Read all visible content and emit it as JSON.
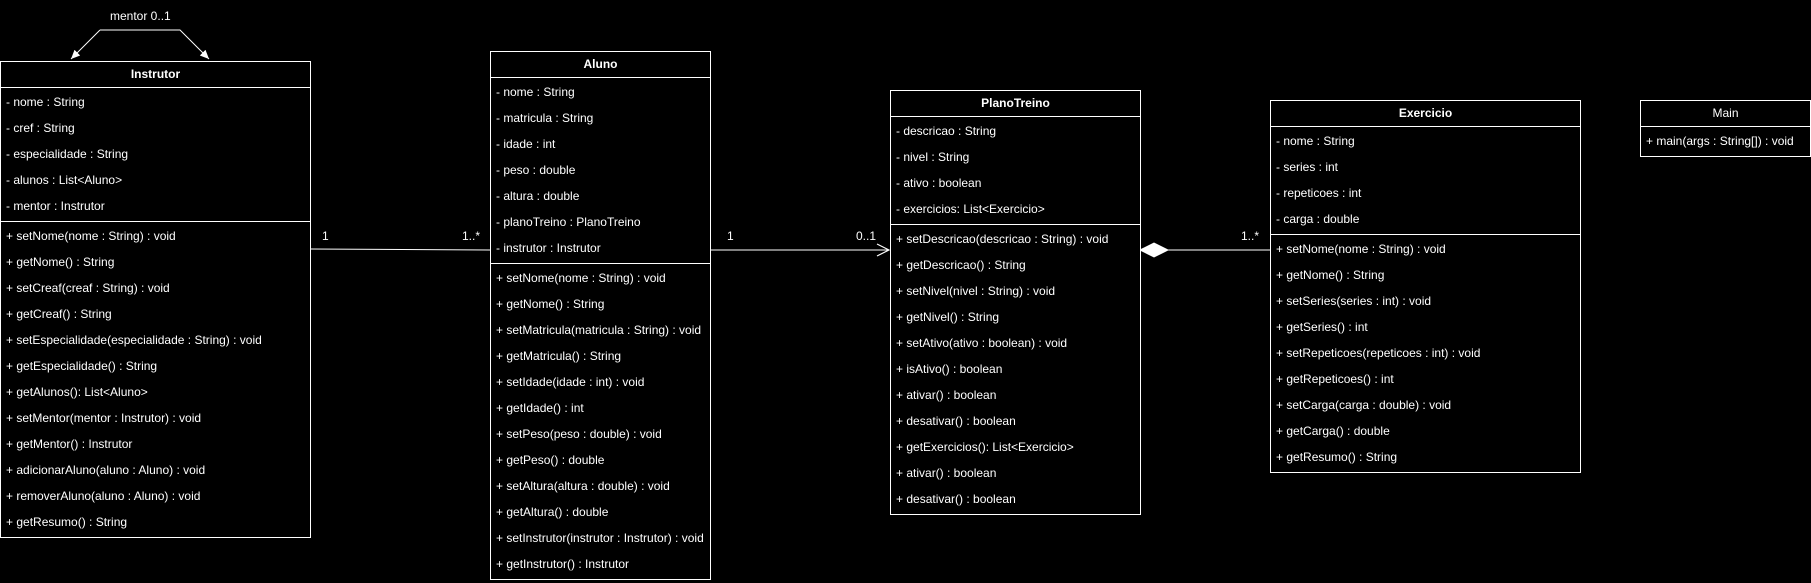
{
  "colors": {
    "background": "#000000",
    "stroke": "#ffffff",
    "text": "#ffffff"
  },
  "classes": {
    "instrutor": {
      "name": "Instrutor",
      "attributes": [
        "- nome : String",
        "- cref : String",
        "- especialidade : String",
        "- alunos : List<Aluno>",
        "- mentor : Instrutor"
      ],
      "methods": [
        "+ setNome(nome : String) : void",
        "+ getNome() : String",
        "+ setCreaf(creaf : String) : void",
        "+ getCreaf() : String",
        "+ setEspecialidade(especialidade : String) : void",
        "+ getEspecialidade() : String",
        "+ getAlunos(): List<Aluno>",
        "+ setMentor(mentor : Instrutor) : void",
        "+ getMentor() : Instrutor",
        "+ adicionarAluno(aluno : Aluno) : void",
        "+ removerAluno(aluno : Aluno) : void",
        "+ getResumo() : String"
      ]
    },
    "aluno": {
      "name": "Aluno",
      "attributes": [
        "- nome : String",
        "- matricula : String",
        "- idade : int",
        "- peso : double",
        "- altura : double",
        "- planoTreino : PlanoTreino",
        "- instrutor : Instrutor"
      ],
      "methods": [
        "+ setNome(nome : String) : void",
        "+ getNome() : String",
        "+ setMatricula(matricula : String) : void",
        "+ getMatricula() : String",
        "+ setIdade(idade : int) : void",
        "+ getIdade() : int",
        "+ setPeso(peso : double) : void",
        "+ getPeso() : double",
        "+ setAltura(altura : double) : void",
        "+ getAltura() : double",
        "+ setInstrutor(instrutor : Instrutor) : void",
        "+ getInstrutor() : Instrutor"
      ]
    },
    "planoTreino": {
      "name": "PlanoTreino",
      "attributes": [
        "- descricao : String",
        "- nivel : String",
        "- ativo : boolean",
        "- exercicios: List<Exercicio>"
      ],
      "methods": [
        "+ setDescricao(descricao : String) : void",
        "+ getDescricao() : String",
        "+ setNivel(nivel : String) : void",
        "+ getNivel() : String",
        "+ setAtivo(ativo : boolean) : void",
        "+ isAtivo() : boolean",
        "+ ativar() : boolean",
        "+ desativar() : boolean",
        "+ getExercicios(): List<Exercicio>",
        "+ ativar() : boolean",
        "+ desativar() : boolean"
      ]
    },
    "exercicio": {
      "name": "Exercicio",
      "attributes": [
        "- nome : String",
        "- series : int",
        "- repeticoes : int",
        "- carga : double"
      ],
      "methods": [
        "+ setNome(nome : String) : void",
        "+ getNome() : String",
        "+ setSeries(series : int) : void",
        "+ getSeries() : int",
        "+ setRepeticoes(repeticoes : int) : void",
        "+ getRepeticoes() : int",
        "+ setCarga(carga : double) : void",
        "+ getCarga() : double",
        "+ getResumo() : String"
      ]
    },
    "main": {
      "name": "Main",
      "methods": [
        "+ main(args : String[]) : void"
      ]
    }
  },
  "relations": {
    "mentor": {
      "label": "mentor 0..1"
    },
    "instrutorAluno": {
      "source": "1",
      "target": "1..*"
    },
    "alunoPlano": {
      "source": "1",
      "target": "0..1"
    },
    "planoExercicio": {
      "target": "1..*"
    }
  }
}
